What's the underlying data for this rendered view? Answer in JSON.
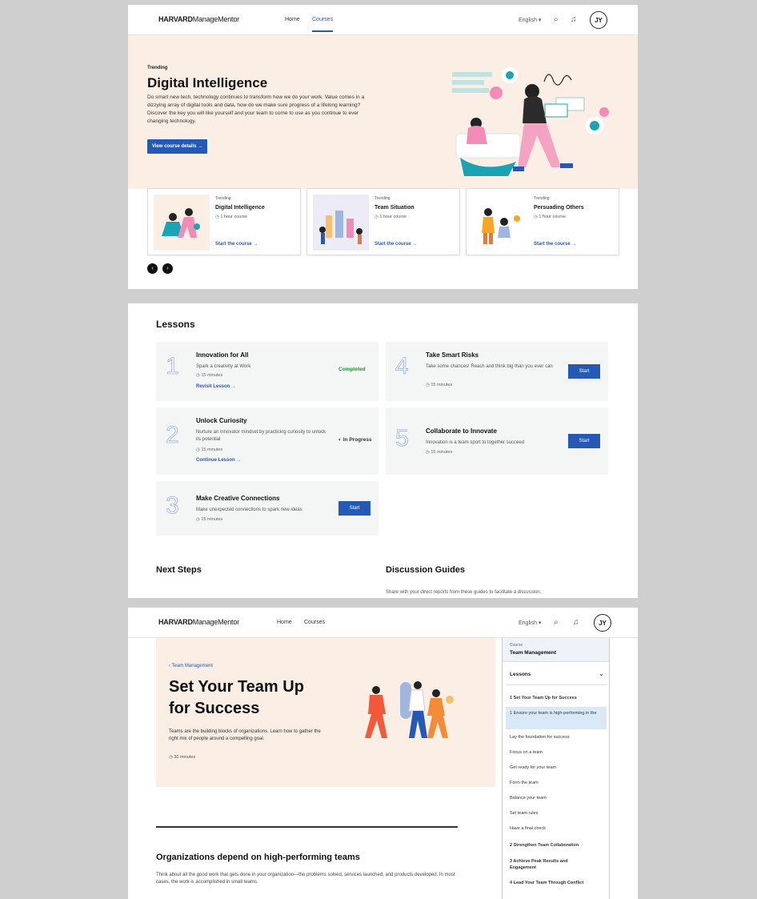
{
  "nav": {
    "logo_bold": "HARVARD",
    "logo_rest": "ManageMentor",
    "home": "Home",
    "courses": "Courses",
    "language": "English ▾",
    "avatar": "JY"
  },
  "hero": {
    "tag": "Trending",
    "title": "Digital Intelligence",
    "description": "Do smart new tech, technology continues to transform how we do your work. Value comes in a dizzying array of digital tools and data, how do we make sure progress of a lifelong learning? Discover the key you will like yourself and your team to come to use as you continue to ever changing technology.",
    "button": "View course details →"
  },
  "cards": [
    {
      "tag": "Trending",
      "title": "Digital Intelligence",
      "duration": "1 hour course",
      "link": "Start the course →"
    },
    {
      "tag": "Trending",
      "title": "Team Situation",
      "duration": "1 hour course",
      "link": "Start the course →"
    },
    {
      "tag": "Trending",
      "title": "Persuading Others",
      "duration": "1 hour course",
      "link": "Start the course →"
    }
  ],
  "carousel": {
    "prev": "‹",
    "next": "›"
  },
  "lessons_section": {
    "title": "Lessons",
    "items": [
      {
        "num": "1",
        "title": "Innovation for All",
        "sub": "Spark a creativity at Work",
        "duration": "15 minutes",
        "link": "Revisit Lesson →",
        "status": "Completed"
      },
      {
        "num": "2",
        "title": "Unlock Curiosity",
        "sub": "Nurture an innovator mindset by practicing curiosity to unlock its potential",
        "duration": "15 minutes",
        "link": "Continue Lesson →",
        "status": "In Progress"
      },
      {
        "num": "3",
        "title": "Make Creative Connections",
        "sub": "Make unexpected connections to spark new ideas",
        "duration": "15 minutes",
        "button": "Start"
      },
      {
        "num": "4",
        "title": "Take Smart Risks",
        "sub": "Take some chances! Reach and think big than you ever can",
        "duration": "15 minutes",
        "button": "Start"
      },
      {
        "num": "5",
        "title": "Collaborate to Innovate",
        "sub": "Innovation is a team sport to together succeed",
        "duration": "15 minutes",
        "button": "Start"
      }
    ]
  },
  "next_steps": {
    "title": "Next Steps"
  },
  "discussion": {
    "title": "Discussion Guides",
    "text": "Share with your direct reports from these guides to facilitate a discussion."
  },
  "course": {
    "breadcrumb": "‹ Team Management",
    "title_line1": "Set Your Team Up",
    "title_line2": "for Success",
    "description": "Teams are the building blocks of organizations. Learn how to gather the right mix of people around a compelling goal.",
    "duration": "30 minutes",
    "section_heading": "Organizations depend on high-performing teams",
    "body": "Think about all the good work that gets done in your organization—the problems solved, services launched, and products developed. In most cases, the work is accomplished in small teams."
  },
  "sidebar": {
    "label": "Course",
    "course_title": "Team Management",
    "lessons_label": "Lessons",
    "chevron": "⌄",
    "items": [
      "1  Set Your Team Up for Success",
      "1 Ensure your team is high-performing in the",
      "Lay the foundation for success",
      "Focus on a team",
      "Get ready for your team",
      "Form the team",
      "Balance your team",
      "Set team rules",
      "Have a final check",
      "2  Strengthen Team Collaboration",
      "3  Achieve Peak Results and Engagement",
      "4  Lead Your Team Through Conflict"
    ]
  },
  "colors": {
    "accent": "#2459b5",
    "hero_bg": "#fbeee4",
    "completed": "#2e8b3a"
  }
}
